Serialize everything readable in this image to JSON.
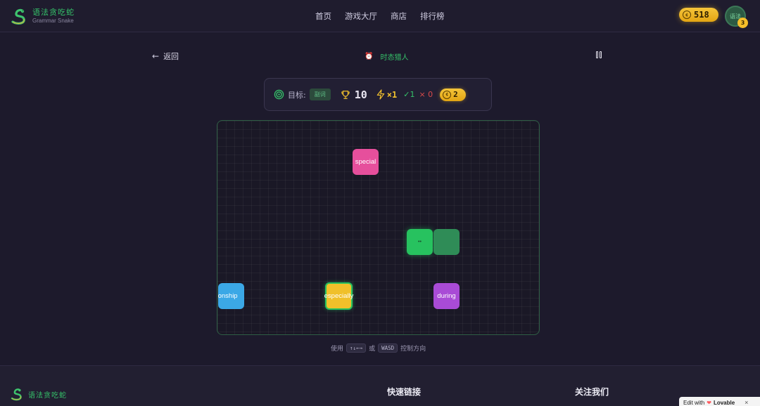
{
  "header": {
    "logo_title": "语法贪吃蛇",
    "logo_subtitle": "Grammar Snake",
    "nav": [
      "首页",
      "游戏大厅",
      "商店",
      "排行榜"
    ],
    "coins": "518",
    "avatar_text": "语法",
    "avatar_badge": "3"
  },
  "subbar": {
    "back_label": "返回",
    "mode_icon": "alarm-clock-icon",
    "mode_label": "时态猎人"
  },
  "status": {
    "target_label": "目标:",
    "target_value": "副词",
    "score": "10",
    "combo": "×1",
    "correct": "✓1",
    "wrong": "× 0",
    "coins": "2"
  },
  "board": {
    "tiles": [
      {
        "word": "special",
        "color": "#e64f9c"
      },
      {
        "word": "relationship",
        "color": "#3ba8e6"
      },
      {
        "word": "especially",
        "color": "#f0c02a"
      },
      {
        "word": "during",
        "color": "#a94bd6"
      }
    ],
    "snake": {
      "head_color": "#27c25f",
      "body_color": "#2f8c57",
      "head_glyph": "••"
    }
  },
  "hint": {
    "prefix": "使用",
    "arrows_key": "↑↓←→",
    "or": "或",
    "wasd_key": "WASD",
    "suffix": "控制方向"
  },
  "footer": {
    "logo_title": "语法贪吃蛇",
    "quick_links": "快速链接",
    "follow_us": "关注我们"
  },
  "badge": {
    "prefix": "Edit with",
    "brand": "Lovable",
    "close": "×"
  },
  "colors": {
    "background": "#1d1a2c",
    "accent_green": "#35c46a",
    "gold": "#f5c53a",
    "board_border": "#2f5e45"
  }
}
